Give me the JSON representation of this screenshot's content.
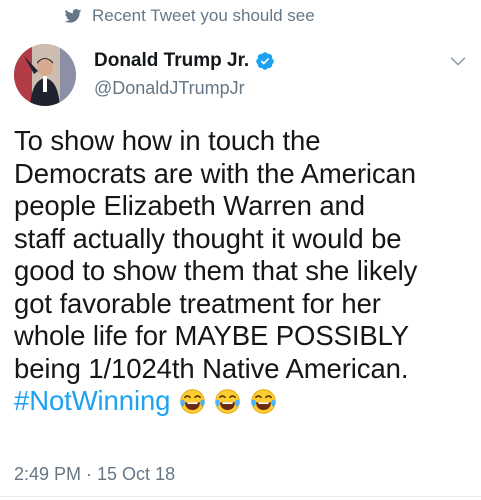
{
  "context": {
    "label": "Recent Tweet you should see",
    "icon": "twitter-bird-icon"
  },
  "tweet": {
    "author": {
      "display_name": "Donald Trump Jr.",
      "handle": "@DonaldJTrumpJr",
      "verified": true
    },
    "text_lines": [
      "To show how in touch the",
      "Democrats are with the American",
      "people Elizabeth Warren and",
      "staff actually thought it would be",
      "good to show them that she likely",
      "got favorable treatment for her",
      "whole life for MAYBE POSSIBLY",
      "being 1/1024th Native American."
    ],
    "hashtag": "#NotWinning",
    "emojis": [
      "laughing-tears-emoji",
      "laughing-tears-emoji",
      "laughing-tears-emoji"
    ],
    "timestamp": "2:49 PM · 15 Oct 18"
  },
  "colors": {
    "link": "#1da1f2",
    "muted": "#657786",
    "text": "#14171a"
  }
}
